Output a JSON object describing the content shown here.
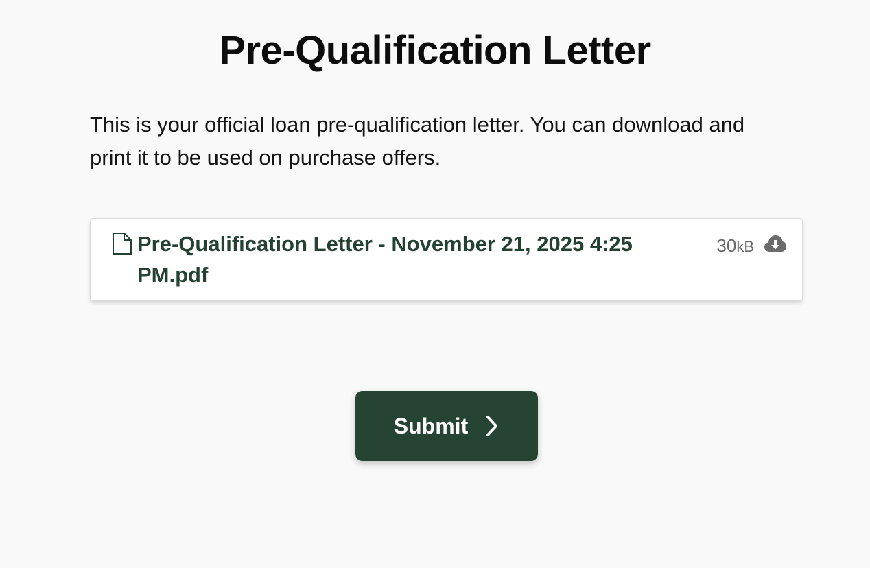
{
  "page": {
    "title": "Pre-Qualification Letter",
    "intro": "This is your official loan pre-qualification letter. You can download and print it to be used on purchase offers."
  },
  "file": {
    "name": "Pre-Qualification Letter - November 21, 2025 4:25 PM.pdf",
    "size_value": "30",
    "size_unit": "kB",
    "icon": "document-icon",
    "action_icon": "cloud-download-icon"
  },
  "actions": {
    "submit_label": "Submit",
    "submit_icon": "chevron-right-icon"
  },
  "colors": {
    "accent": "#264434",
    "file_name": "#244232",
    "muted": "#6a6a6a"
  }
}
